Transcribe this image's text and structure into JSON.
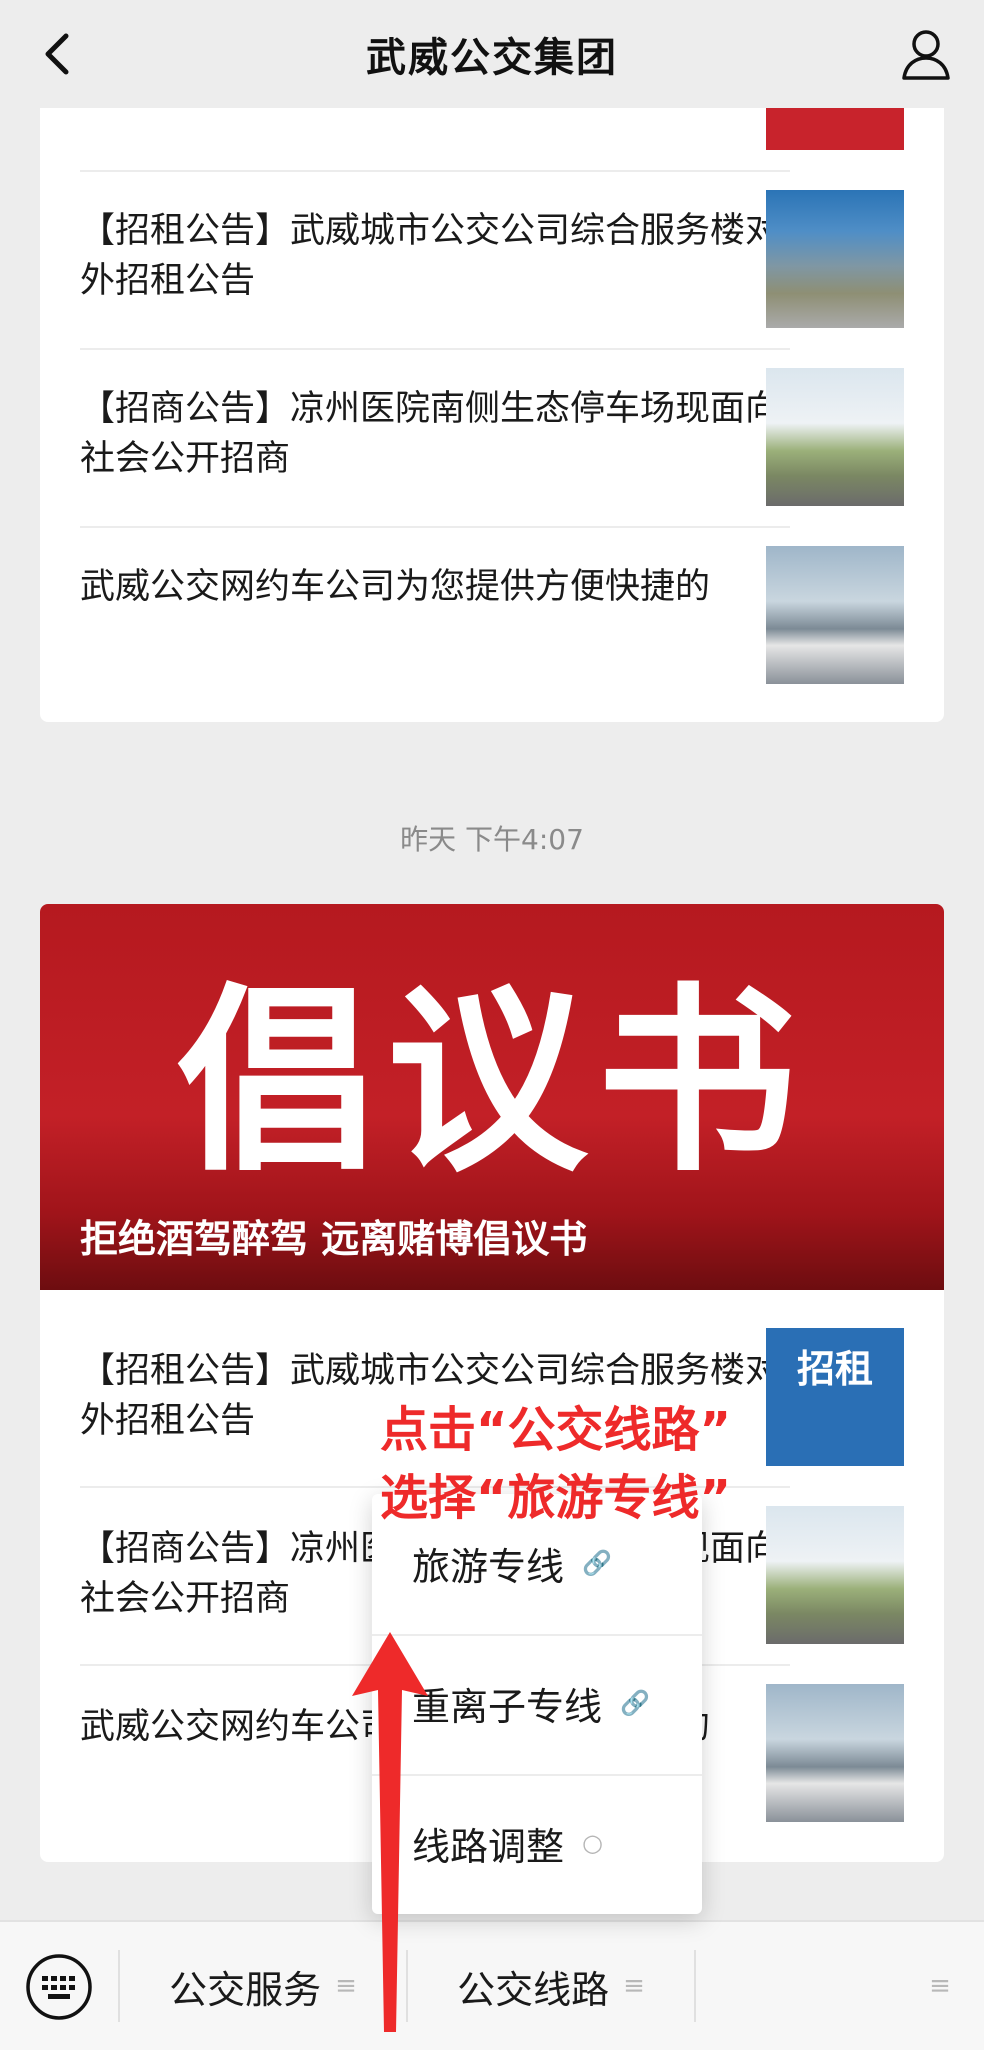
{
  "header": {
    "title": "武威公交集团",
    "back_icon": "chevron-left-icon",
    "profile_icon": "user-icon"
  },
  "card1": {
    "items": [
      {
        "title": "【招租公告】武威城市公交公司综合服务楼对外招租公告"
      },
      {
        "title": "【招商公告】凉州医院南侧生态停车场现面向社会公开招商"
      },
      {
        "title": "武威公交网约车公司为您提供方便快捷的"
      }
    ]
  },
  "timestamp": "昨天 下午4:07",
  "card2": {
    "banner_title": "倡议书",
    "banner_caption": "拒绝酒驾醉驾 远离赌博倡议书",
    "items": [
      {
        "title": "【招租公告】武威城市公交公司综合服务楼对外招租公告",
        "thumb_text": "招租"
      },
      {
        "title": "【招商公告】凉州医院南侧生态停车场现面向社会公开招商"
      },
      {
        "title": "武威公交网约车公司为您提供方便快捷的"
      }
    ]
  },
  "popup": {
    "items": [
      {
        "label": "旅游专线",
        "icon": "link-icon"
      },
      {
        "label": "重离子专线",
        "icon": "link-icon"
      },
      {
        "label": "线路调整",
        "icon": "speech-bubble-icon"
      }
    ]
  },
  "annotation": {
    "line1": "点击“公交线路”",
    "line2": "选择“旅游专线”",
    "color": "#ee2a2a"
  },
  "bottom_menu": {
    "keyboard_icon": "keyboard-icon",
    "items": [
      {
        "label": "公交服务"
      },
      {
        "label": "公交线路"
      }
    ]
  }
}
